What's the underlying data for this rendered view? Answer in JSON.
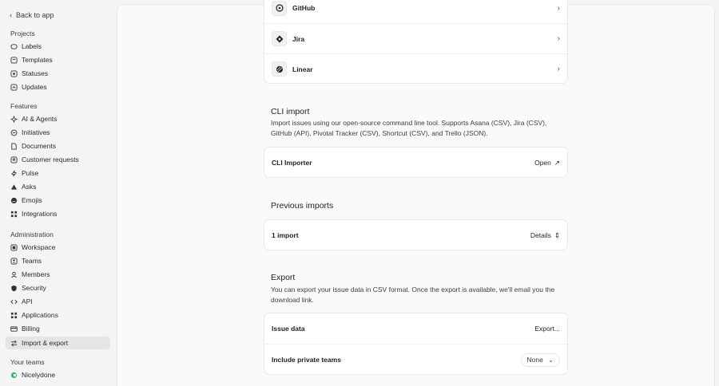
{
  "sidebar": {
    "back_label": "Back to app",
    "sections": {
      "projects": "Projects",
      "features": "Features",
      "administration": "Administration",
      "your_teams": "Your teams"
    },
    "projects": [
      "Labels",
      "Templates",
      "Statuses",
      "Updates"
    ],
    "features": [
      "AI & Agents",
      "Initiatives",
      "Documents",
      "Customer requests",
      "Pulse",
      "Asks",
      "Emojis",
      "Integrations"
    ],
    "administration": [
      "Workspace",
      "Teams",
      "Members",
      "Security",
      "API",
      "Applications",
      "Billing",
      "Import & export"
    ],
    "teams": [
      "Nicelydone"
    ],
    "active_item": "Import & export",
    "team_color": "#2fb36b"
  },
  "integrations": {
    "items": [
      {
        "label": "GitHub",
        "icon": "github-icon"
      },
      {
        "label": "Jira",
        "icon": "jira-icon"
      },
      {
        "label": "Linear",
        "icon": "linear-icon"
      }
    ]
  },
  "cli": {
    "title": "CLI import",
    "description": "Import issues using our open-source command line tool. Supports Asana (CSV), Jira (CSV), GitHub (API), Pivotal Tracker (CSV), Shortcut (CSV), and Trello (JSON).",
    "row_label": "CLI Importer",
    "action_label": "Open"
  },
  "previous": {
    "title": "Previous imports",
    "row_label": "1 import",
    "action_label": "Details"
  },
  "export": {
    "title": "Export",
    "description": "You can export your issue data in CSV format. Once the export is available, we'll email you the download link.",
    "issue_label": "Issue data",
    "export_button": "Export...",
    "private_label": "Include private teams",
    "private_value": "None"
  }
}
